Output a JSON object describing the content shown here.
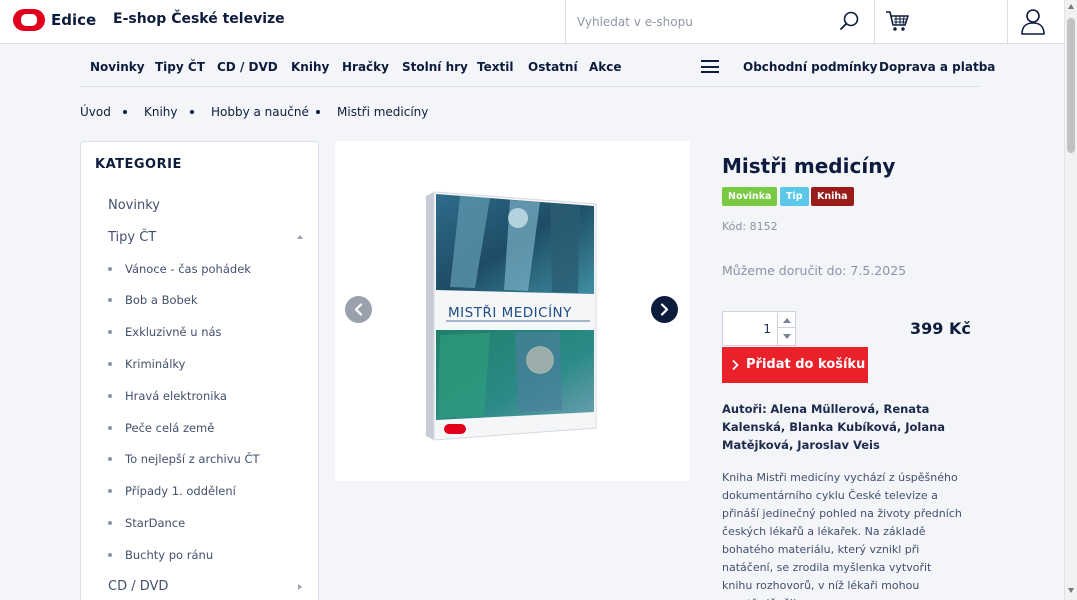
{
  "header": {
    "logo_text": "Edice",
    "shop_title": "E-shop České televize",
    "search_placeholder": "Vyhledat v e-shopu"
  },
  "nav": {
    "items": [
      "Novinky",
      "Tipy ČT",
      "CD / DVD",
      "Knihy",
      "Hračky",
      "Stolní hry",
      "Textil",
      "Ostatní",
      "Akce"
    ],
    "right_items": [
      "Obchodní podmínky",
      "Doprava a platba"
    ]
  },
  "breadcrumb": [
    "Úvod",
    "Knihy",
    "Hobby a naučné",
    "Mistři medicíny"
  ],
  "sidebar": {
    "title": "KATEGORIE",
    "top_items": [
      "Novinky",
      "Tipy ČT"
    ],
    "sub_items": [
      "Vánoce - čas pohádek",
      "Bob a Bobek",
      "Exkluzivně u nás",
      "Kriminálky",
      "Hravá elektronika",
      "Peče celá země",
      "To nejlepší z archivu ČT",
      "Případy 1. oddělení",
      "StarDance",
      "Buchty po ránu"
    ],
    "bottom_item": "CD / DVD"
  },
  "product": {
    "title": "Mistři medicíny",
    "badges": [
      "Novinka",
      "Tip",
      "Kniha"
    ],
    "code": "Kód: 8152",
    "delivery": "Můžeme doručit do: 7.5.2025",
    "quantity": "1",
    "price": "399 Kč",
    "add_to_cart": "Přidat do košíku",
    "authors_label": "Autoři:",
    "authors": "Alena Müllerová, Renata Kalenská, Blanka Kubíková, Jolana Matějková, Jaroslav Veis",
    "description": "Kniha Mistři medicíny vychází z úspěšného dokumentárního cyklu České televize a přináší jedinečný pohled na životy předních českých lékařů a lékařek. Na základě bohatého materiálu, který vznikl při natáčení, se zrodila myšlenka vytvořit knihu rozhovorů, v níž lékaři mohou soustředěněji",
    "cover_title": "MISTŘI MEDICÍNY"
  },
  "colors": {
    "brand_red": "#e0001b",
    "navy": "#0d1c3d",
    "cta_red": "#e8212a",
    "badge_novinka": "#7ac943",
    "badge_tip": "#5bc8e9",
    "badge_kniha": "#9b1b1b"
  },
  "icons": [
    "search-icon",
    "cart-icon",
    "user-icon",
    "menu-icon",
    "chevron-left-icon",
    "chevron-right-icon"
  ]
}
